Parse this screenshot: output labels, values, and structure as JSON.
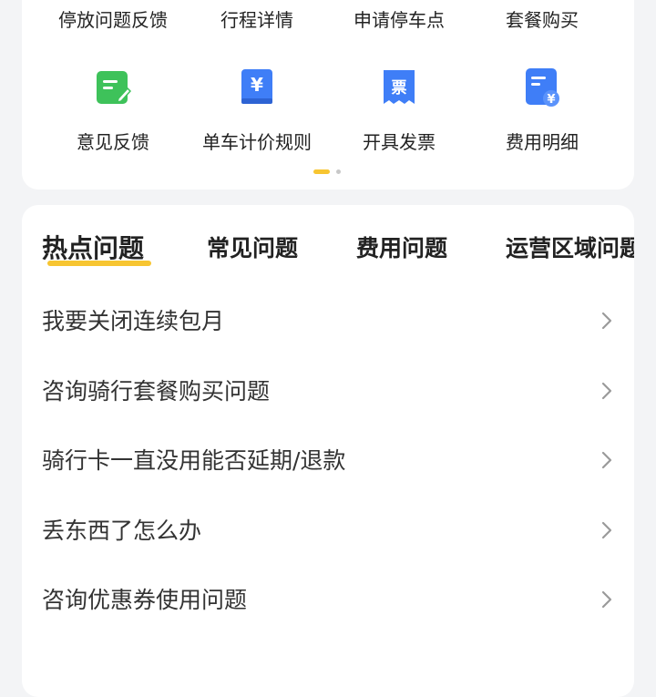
{
  "top_row": [
    "停放问题反馈",
    "行程详情",
    "申请停车点",
    "套餐购买"
  ],
  "services": [
    {
      "label": "意见反馈",
      "icon": "feedback-icon",
      "color": "#3ec25a"
    },
    {
      "label": "单车计价规则",
      "icon": "pricing-rules-icon",
      "color": "#3f7ef7"
    },
    {
      "label": "开具发票",
      "icon": "invoice-icon",
      "color": "#3f7ef7"
    },
    {
      "label": "费用明细",
      "icon": "fee-details-icon",
      "color": "#3f7ef7"
    }
  ],
  "pager": {
    "pages": 2,
    "active": 1
  },
  "tabs": [
    {
      "label": "热点问题",
      "active": true
    },
    {
      "label": "常见问题",
      "active": false
    },
    {
      "label": "费用问题",
      "active": false
    },
    {
      "label": "运营区域问题",
      "active": false
    }
  ],
  "faq": [
    "我要关闭连续包月",
    "咨询骑行套餐购买问题",
    "骑行卡一直没用能否延期/退款",
    "丢东西了怎么办",
    "咨询优惠券使用问题"
  ],
  "colors": {
    "accent": "#f7c531",
    "green": "#3ec25a",
    "blue": "#3f7ef7"
  }
}
